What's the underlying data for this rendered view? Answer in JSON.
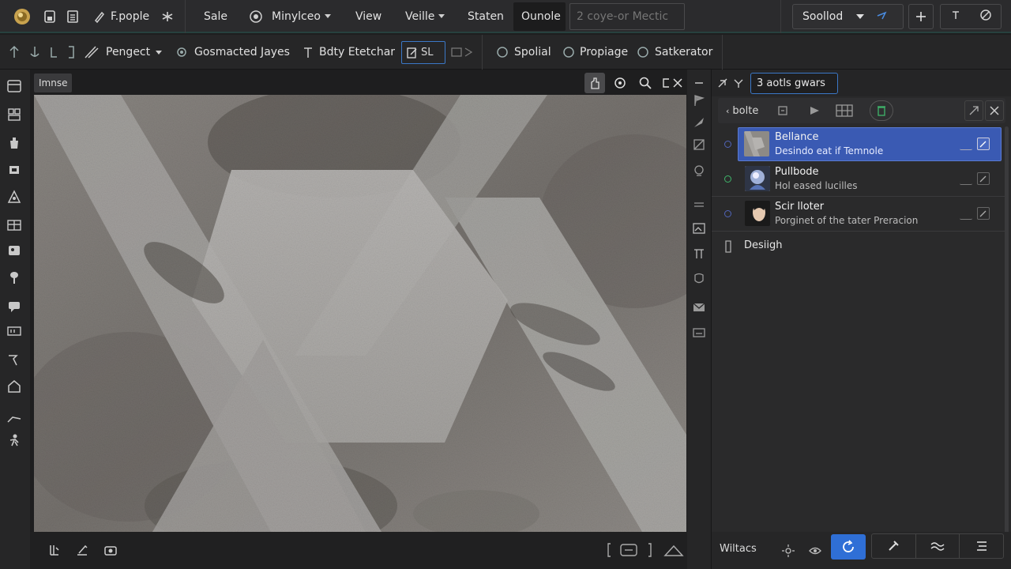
{
  "menubar": {
    "app_name": "F.pople",
    "menus": [
      "Sale",
      "Minylceo",
      "View",
      "Veille",
      "Staten",
      "Ounole"
    ],
    "search_placeholder": "2 coye-or Mectic",
    "mode_select": "Soollod"
  },
  "toolbar": {
    "dropdown_label": "Pengect",
    "items": [
      "Gosmacted Jayes",
      "Bdty Etetchar",
      "SL",
      "Spolial",
      "Propiage",
      "Satkerator"
    ]
  },
  "canvas": {
    "tab_label": "Imnse"
  },
  "panel": {
    "search_value": "3 aotls gwars",
    "back_label": "bolte",
    "layers": [
      {
        "name": "Bellance",
        "desc": "Desindo eat if Temnole",
        "color": "#5064b8",
        "selected": true
      },
      {
        "name": "Pullbode",
        "desc": "Hol eased lucilles",
        "color": "#3fb56a",
        "selected": false
      },
      {
        "name": "Scir lloter",
        "desc": "Porginet of the tater Preracion",
        "color": "#5064b8",
        "selected": false
      }
    ],
    "group_label": "Desiigh",
    "footer_label": "Wiltacs"
  },
  "colors": {
    "accent": "#3b78c7",
    "selected_row": "#3a5ab3",
    "green_dot": "#3fb56a"
  }
}
